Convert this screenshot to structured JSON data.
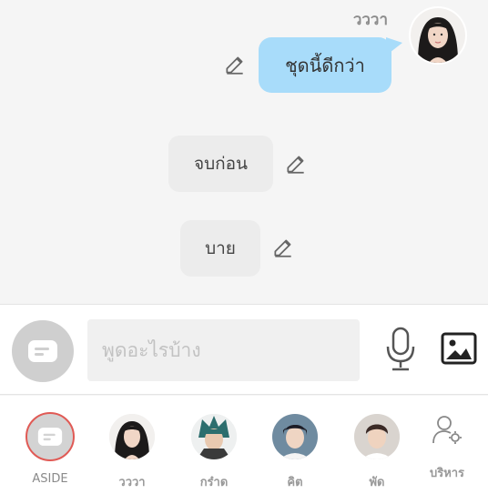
{
  "chat": {
    "sender_name": "วววา",
    "messages": [
      {
        "text": "ชุดนี้ดีกว่า",
        "from": "me"
      },
      {
        "text": "จบก่อน",
        "from": "action"
      },
      {
        "text": "บาย",
        "from": "action"
      }
    ]
  },
  "input": {
    "placeholder": "พูดอะไรบ้าง",
    "aside_icon": "chat-lines-icon",
    "mic_icon": "microphone-icon",
    "image_icon": "image-icon"
  },
  "characters": [
    {
      "label": "ASIDE"
    },
    {
      "label": "วววา"
    },
    {
      "label": "กร๋าด"
    },
    {
      "label": "คิต"
    },
    {
      "label": "พัด"
    }
  ],
  "manage": {
    "label": "บริหาร",
    "icon": "user-settings-icon"
  },
  "colors": {
    "bubble": "#a8dcfa",
    "aside_ring": "#e05a55",
    "background": "#f5f5f5"
  }
}
